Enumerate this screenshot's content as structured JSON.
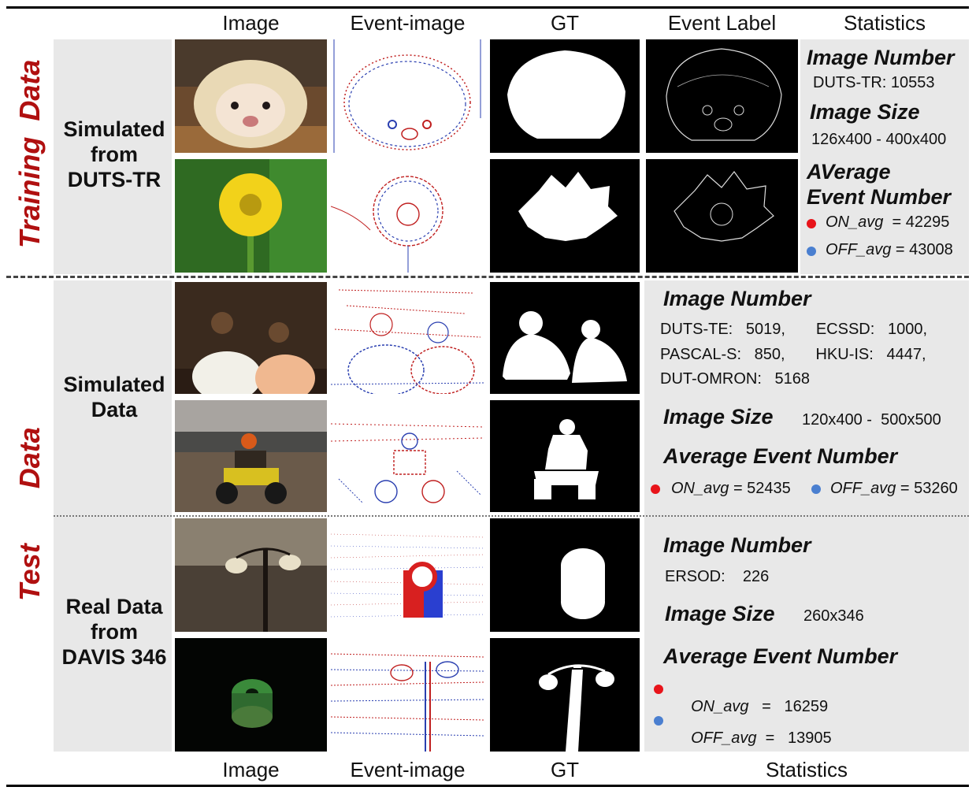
{
  "header_columns": [
    "Image",
    "Event-image",
    "GT",
    "Event Label",
    "Statistics"
  ],
  "footer_columns": [
    "Image",
    "Event-image",
    "GT",
    "Statistics"
  ],
  "side_labels": {
    "training": [
      "Training",
      "Data"
    ],
    "test": [
      "Test",
      "Data"
    ]
  },
  "row_labels": {
    "training": "Simulated\nfrom\nDUTS-TR",
    "test_simulated": "Simulated\nData",
    "test_real": "Real Data\nfrom\nDAVIS 346"
  },
  "training_stats": {
    "image_number_title": "Image Number",
    "image_number_text": "DUTS-TR:   10553",
    "image_size_title": "Image Size",
    "image_size_text": "126x400 -  400x400",
    "avg_title_line1": "AVerage",
    "avg_title_line2": "Event Number",
    "on_label": "ON_avg",
    "on_value": "= 42295",
    "off_label": "OFF_avg",
    "off_value": "= 43008"
  },
  "sim_stats": {
    "image_number_title": "Image Number",
    "lines": [
      "DUTS-TE:   5019,       ECSSD:   1000,",
      "PASCAL-S:   850,       HKU-IS:   4447,",
      "DUT-OMRON:   5168"
    ],
    "image_size_title": "Image Size",
    "image_size_text": "120x400 -  500x500",
    "avg_title": "Average Event Number",
    "on_label": "ON_avg",
    "on_value": "= 52435",
    "off_label": "OFF_avg",
    "off_value": "= 53260"
  },
  "real_stats": {
    "image_number_title": "Image Number",
    "image_number_text": "ERSOD:    226",
    "image_size_title": "Image Size",
    "image_size_text": "260x346",
    "avg_title": "Average Event Number",
    "on_label": "ON_avg",
    "on_value": "=   16259",
    "off_label": "OFF_avg",
    "off_value": "=   13905"
  },
  "colors": {
    "on_dot": "#e8141a",
    "off_dot": "#4a7fd0",
    "side_label": "#b01010",
    "panel": "#e8e8e8"
  }
}
